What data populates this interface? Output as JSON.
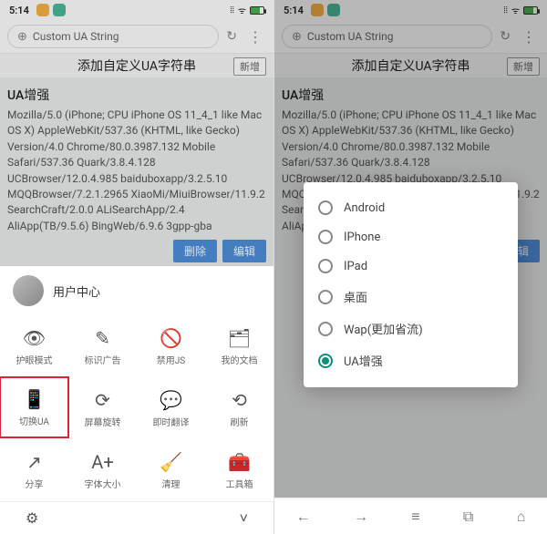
{
  "status": {
    "time": "5:14",
    "dots": [
      "#f5b24a",
      "#4db89a"
    ],
    "signal": "⦙⦙",
    "wifi": "ᯤ",
    "battery": "⚡"
  },
  "urlbar": {
    "globe": "⊕",
    "label": "Custom UA String",
    "refresh": "↻",
    "more": "⋮"
  },
  "titlerow": {
    "title": "添加自定义UA字符串",
    "add": "新增"
  },
  "ua": {
    "heading": "UA增强",
    "body": "Mozilla/5.0 (iPhone; CPU iPhone OS 11_4_1 like Mac OS X) AppleWebKit/537.36 (KHTML, like Gecko) Version/4.0 Chrome/80.0.3987.132 Mobile Safari/537.36 Quark/3.8.4.128 UCBrowser/12.0.4.985 baiduboxapp/3.2.5.10 MQQBrowser/7.2.1.2965 XiaoMi/MiuiBrowser/11.9.2 SearchCraft/2.0.0 ALiSearchApp/2.4 AliApp(TB/9.5.6) BingWeb/6.9.6 3gpp-gba",
    "delete": "删除",
    "edit": "编辑"
  },
  "panel": {
    "user": "用户中心",
    "tools": [
      {
        "icon": "👁",
        "label": "护眼模式",
        "name": "eye-mode"
      },
      {
        "icon": "✎",
        "label": "标识广告",
        "name": "mark-ads"
      },
      {
        "icon": "🚫",
        "label": "禁用JS",
        "name": "disable-js"
      },
      {
        "icon": "🗂",
        "label": "我的文档",
        "name": "my-docs"
      },
      {
        "icon": "📱",
        "label": "切换UA",
        "name": "switch-ua",
        "hl": true
      },
      {
        "icon": "⟳",
        "label": "屏幕旋转",
        "name": "rotate"
      },
      {
        "icon": "💬",
        "label": "即时翻译",
        "name": "translate"
      },
      {
        "icon": "⟲",
        "label": "刷新",
        "name": "refresh"
      },
      {
        "icon": "↗",
        "label": "分享",
        "name": "share"
      },
      {
        "icon": "A+",
        "label": "字体大小",
        "name": "font-size"
      },
      {
        "icon": "🧹",
        "label": "清理",
        "name": "clean"
      },
      {
        "icon": "🧰",
        "label": "工具箱",
        "name": "toolbox"
      }
    ],
    "footer": {
      "settings": "⚙",
      "down": "˅"
    }
  },
  "dialog": {
    "options": [
      {
        "label": "Android",
        "sel": false
      },
      {
        "label": "IPhone",
        "sel": false
      },
      {
        "label": "IPad",
        "sel": false
      },
      {
        "label": "桌面",
        "sel": false
      },
      {
        "label": "Wap(更加省流)",
        "sel": false
      },
      {
        "label": "UA增强",
        "sel": true
      }
    ]
  },
  "bottomnav": {
    "back": "←",
    "fwd": "→",
    "menu": "≡",
    "tabs": "⧉",
    "home": "⌂"
  }
}
